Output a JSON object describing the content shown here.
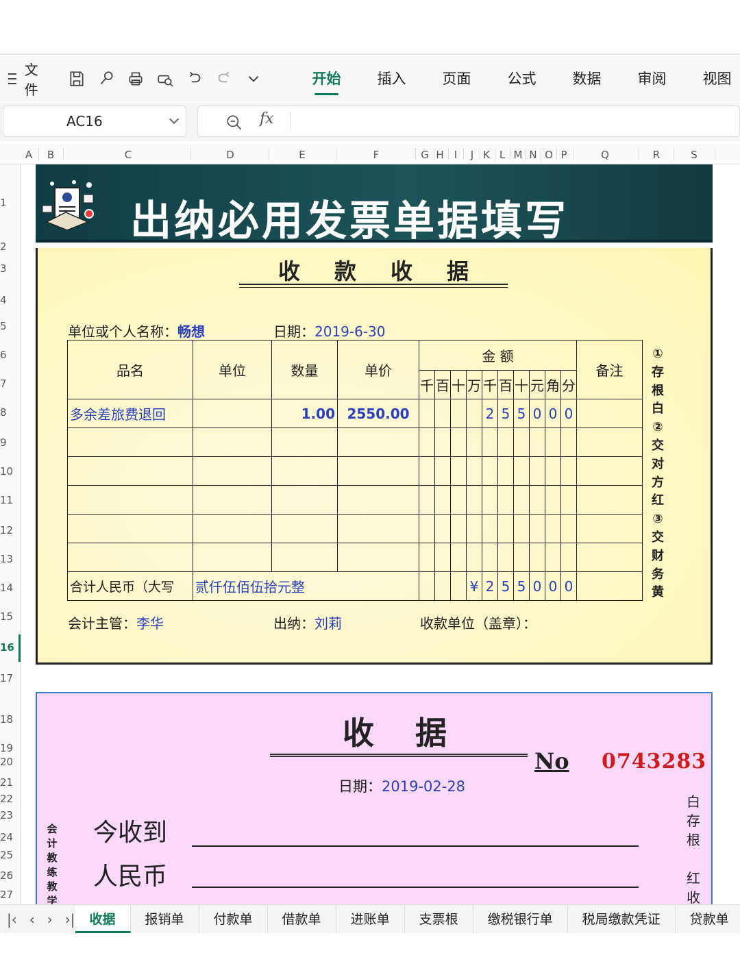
{
  "menu": {
    "file": "文件"
  },
  "tabs": [
    "开始",
    "插入",
    "页面",
    "公式",
    "数据",
    "审阅",
    "视图"
  ],
  "namebox": "AC16",
  "columns": [
    "A",
    "B",
    "C",
    "D",
    "E",
    "F",
    "G",
    "H",
    "I",
    "J",
    "K",
    "L",
    "M",
    "N",
    "O",
    "P",
    "Q",
    "R",
    "S"
  ],
  "rows": [
    "1",
    "2",
    "3",
    "4",
    "5",
    "6",
    "7",
    "8",
    "9",
    "10",
    "11",
    "12",
    "13",
    "14",
    "15",
    "16",
    "17",
    "18",
    "19",
    "20",
    "21",
    "22",
    "23",
    "24",
    "25",
    "26",
    "27"
  ],
  "banner": {
    "title": "出纳必用发票单据填写"
  },
  "receipt1": {
    "title": "收款收据",
    "payer_label": "单位或个人名称：",
    "payer": "畅想",
    "date_label": "日期：",
    "date": "2019-6-30",
    "headers": {
      "name": "品名",
      "unit": "单位",
      "qty": "数量",
      "price": "单价",
      "amount": "金 额",
      "note": "备注"
    },
    "digit_headers": [
      "千",
      "百",
      "十",
      "万",
      "千",
      "百",
      "十",
      "元",
      "角",
      "分"
    ],
    "item": {
      "name": "多余差旅费退回",
      "qty": "1.00",
      "price": "2550.00",
      "digits": [
        "",
        "",
        "",
        "",
        "2",
        "5",
        "5",
        "0",
        "0",
        "0"
      ]
    },
    "total_label": "合计人民币（大写",
    "total_words": "贰仟伍佰伍拾元整",
    "total_digits": [
      "",
      "",
      "",
      "¥",
      "2",
      "5",
      "5",
      "0",
      "0",
      "0"
    ],
    "accountant_label": "会计主管：",
    "accountant": "李华",
    "cashier_label": "出纳：",
    "cashier": "刘莉",
    "payee_label": "收款单位（盖章）：",
    "side_note": [
      "①",
      "存",
      "根",
      "白",
      "②",
      "交",
      "对",
      "方",
      "红",
      "③",
      "交",
      "财",
      "务",
      "黄"
    ]
  },
  "receipt2": {
    "title": "收据",
    "no_label": "No",
    "no": "0743283",
    "date_label": "日期：",
    "date": "2019-02-28",
    "received_label": "今收到",
    "rmb_label": "人民币",
    "left_vertical": [
      "会",
      "计",
      "教",
      "练",
      "教",
      "学"
    ],
    "right_vertical": [
      "白",
      "存",
      "根",
      "",
      "红",
      "收"
    ]
  },
  "sheets": [
    "收据",
    "报销单",
    "付款单",
    "借款单",
    "进账单",
    "支票根",
    "缴税银行单",
    "税局缴款凭证",
    "贷款单"
  ]
}
